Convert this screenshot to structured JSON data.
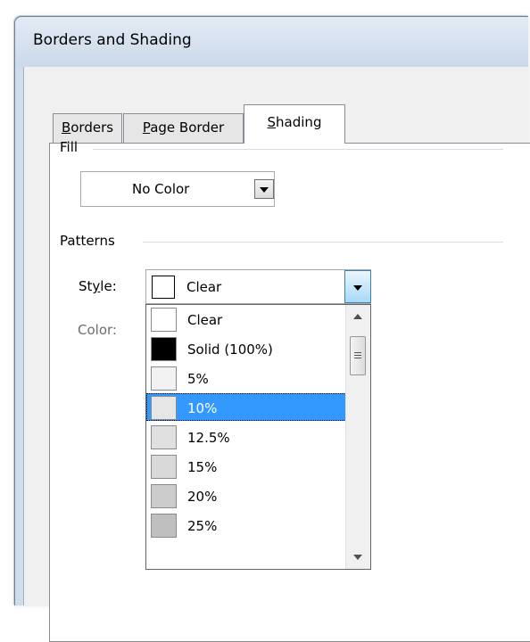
{
  "dialog": {
    "title": "Borders and Shading"
  },
  "tabs": [
    {
      "label_pre": "",
      "accel": "B",
      "label_post": "orders",
      "active": false
    },
    {
      "label_pre": "",
      "accel": "P",
      "label_post": "age Border",
      "active": false
    },
    {
      "label_pre": "",
      "accel": "S",
      "label_post": "hading",
      "active": true
    }
  ],
  "fill": {
    "section_label": "Fill",
    "value": "No Color"
  },
  "patterns": {
    "section_label": "Patterns",
    "style_label_pre": "St",
    "style_label_accel": "y",
    "style_label_post": "le:",
    "style_value": "Clear",
    "color_label": "Color:"
  },
  "style_options": [
    {
      "label": "Clear",
      "swatch": "#ffffff"
    },
    {
      "label": "Solid (100%)",
      "swatch": "#000000"
    },
    {
      "label": "5%",
      "swatch": "#f2f2f2"
    },
    {
      "label": "10%",
      "swatch": "#e6e6e6",
      "selected": true
    },
    {
      "label": "12.5%",
      "swatch": "#e0e0e0"
    },
    {
      "label": "15%",
      "swatch": "#d9d9d9"
    },
    {
      "label": "20%",
      "swatch": "#cccccc"
    },
    {
      "label": "25%",
      "swatch": "#bfbfbf"
    }
  ],
  "colors": {
    "selection": "#3399ff",
    "titlebar": "#cbd9ea"
  }
}
